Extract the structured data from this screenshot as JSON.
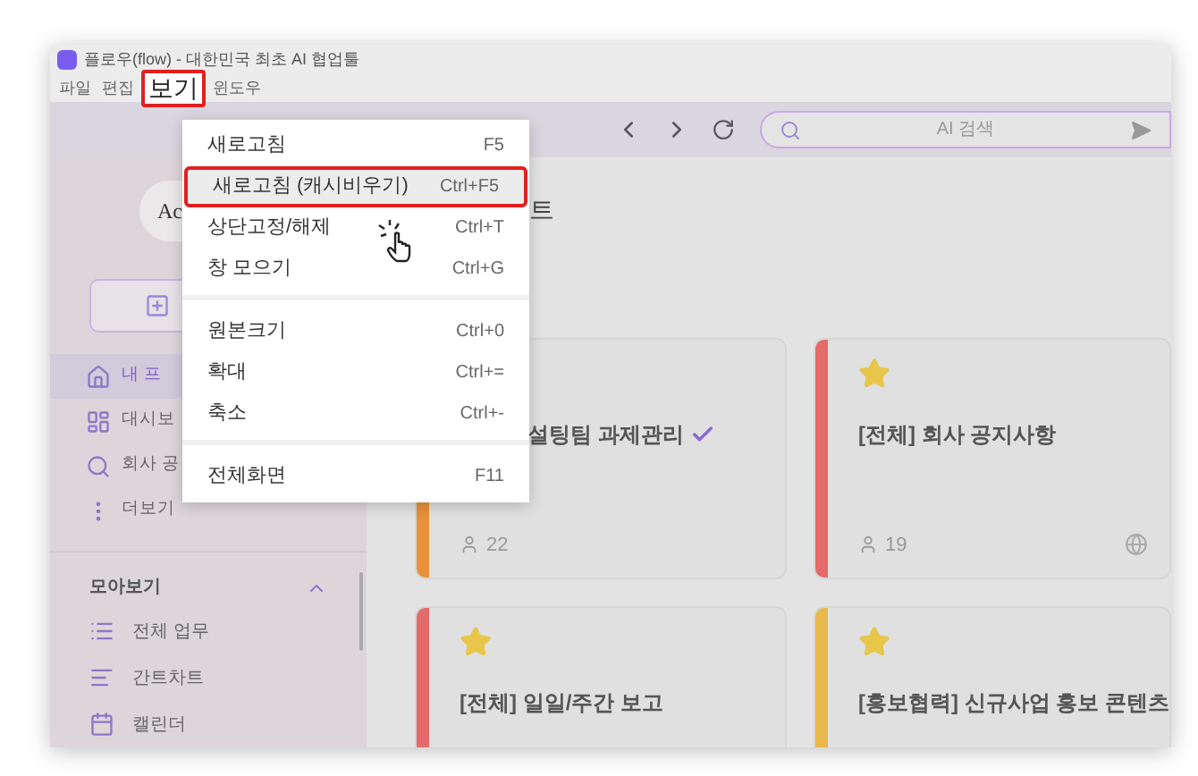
{
  "window": {
    "title": "플로우(flow) - 대한민국 최초 AI 협업툴"
  },
  "menu_bar": [
    {
      "label": "파일",
      "selected": false
    },
    {
      "label": "편집",
      "selected": false
    },
    {
      "label": "보기",
      "selected": true
    },
    {
      "label": "윈도우",
      "selected": false
    }
  ],
  "toolbar": {
    "search": {
      "placeholder": "AI 검색"
    }
  },
  "sidebar": {
    "logo": "Ac",
    "nav": [
      {
        "label": "내 프",
        "selected": true
      },
      {
        "label": "대시보",
        "selected": false
      },
      {
        "label": "회사 공",
        "selected": false
      },
      {
        "label": "더보기",
        "selected": false
      }
    ],
    "section": {
      "title": "모아보기",
      "expanded": true,
      "items": [
        "전체 업무",
        "간트차트",
        "캘린더"
      ]
    }
  },
  "content": {
    "heading": "트",
    "cards": [
      {
        "title": "설팅팀 과제관리",
        "color": "#e8913a",
        "checked": true,
        "members": "22"
      },
      {
        "title": "[전체] 회사 공지사항",
        "color": "#e56a6a",
        "starred": true,
        "members": "19",
        "public": true
      },
      {
        "title": "[전체] 일일/주간 보고",
        "color": "#e56a6a",
        "starred": true
      },
      {
        "title": "[홍보협력] 신규사업 홍보 콘텐츠",
        "color": "#e8b84a",
        "starred": true
      }
    ]
  },
  "view_menu": {
    "groups": [
      [
        {
          "label": "새로고침",
          "shortcut": "F5",
          "highlighted": false
        },
        {
          "label": "새로고침 (캐시비우기)",
          "shortcut": "Ctrl+F5",
          "highlighted": true
        },
        {
          "label": "상단고정/해제",
          "shortcut": "Ctrl+T",
          "highlighted": false
        },
        {
          "label": "창 모으기",
          "shortcut": "Ctrl+G",
          "highlighted": false
        }
      ],
      [
        {
          "label": "원본크기",
          "shortcut": "Ctrl+0",
          "highlighted": false
        },
        {
          "label": "확대",
          "shortcut": "Ctrl+=",
          "highlighted": false
        },
        {
          "label": "축소",
          "shortcut": "Ctrl+-",
          "highlighted": false
        }
      ],
      [
        {
          "label": "전체화면",
          "shortcut": "F11",
          "highlighted": false
        }
      ]
    ]
  }
}
